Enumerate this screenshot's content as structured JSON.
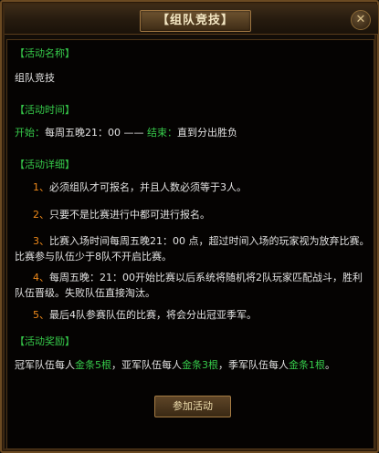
{
  "dialog": {
    "title": "【组队竞技】",
    "close_glyph": "✕"
  },
  "sections": {
    "name_title": "【活动名称】",
    "name_value": "组队竞技",
    "time_title": "【活动时间】",
    "time_start_label": "开始：",
    "time_start_value": "每周五晚21：00 —— ",
    "time_end_label": "结束：",
    "time_end_value": "直到分出胜负",
    "detail_title": "【活动详细】",
    "details": [
      {
        "num": "1、",
        "text": "必须组队才可报名，并且人数必须等于3人。"
      },
      {
        "num": "2、",
        "text": "只要不是比赛进行中都可进行报名。"
      },
      {
        "num": "3、",
        "text": "比赛入场时间每周五晚21：00 点，超过时间入场的玩家视为放弃比赛。比赛参与队伍少于8队不开启比赛。"
      },
      {
        "num": "4、",
        "text": "每周五晚：21：00开始比赛以后系统将随机将2队玩家匹配战斗，胜利队伍晋级。失败队伍直接淘汰。"
      },
      {
        "num": "5、",
        "text": "最后4队参赛队伍的比赛，将会分出冠亚季军。"
      }
    ],
    "reward_title": "【活动奖励】",
    "reward": {
      "p1": "冠军队伍每人",
      "g1": "金条5根",
      "p2": "，亚军队伍每人",
      "g2": "金条3根",
      "p3": "，季军队伍每人",
      "g3": "金条1根",
      "p4": "。"
    }
  },
  "join_button_label": "参加活动",
  "colors": {
    "accent_green": "#36c94a",
    "accent_orange": "#f08a1a",
    "text": "#e2e2e2"
  }
}
